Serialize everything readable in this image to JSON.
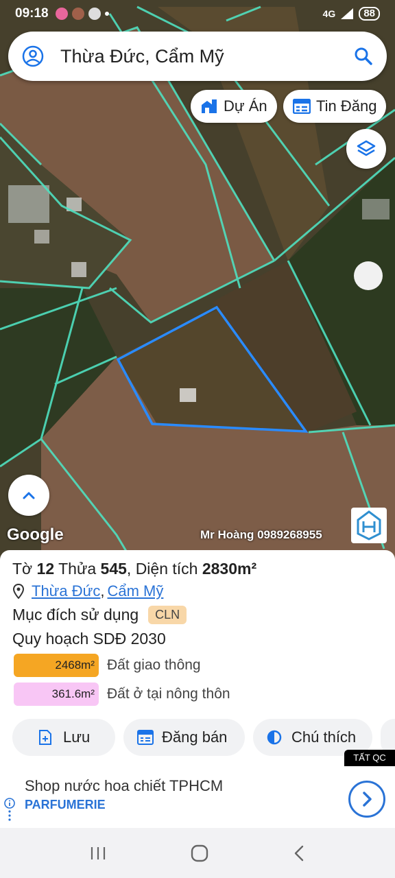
{
  "status_bar": {
    "time": "09:18",
    "network": "4G",
    "battery": "88"
  },
  "search": {
    "query": "Thừa Đức, Cẩm Mỹ"
  },
  "chips": {
    "projects": "Dự Án",
    "listings": "Tin Đăng"
  },
  "map": {
    "attribution": "Google",
    "watermark": "Mr Hoàng 0989268955"
  },
  "parcel": {
    "sheet_label": "Tờ",
    "sheet_no": "12",
    "plot_label": "Thửa",
    "plot_no": "545",
    "area_label": "Diện tích",
    "area_value": "2830m²",
    "commune": "Thừa Đức",
    "district": "Cẩm Mỹ",
    "purpose_label": "Mục đích sử dụng",
    "purpose_code": "CLN",
    "plan_label": "Quy hoạch SDĐ 2030",
    "zones": [
      {
        "area": "2468m²",
        "name": "Đất giao thông",
        "color": "#f5a623"
      },
      {
        "area": "361.6m²",
        "name": "Đất ở tại nông thôn",
        "color": "#f8c6f5"
      }
    ]
  },
  "actions": {
    "save": "Lưu",
    "post": "Đăng bán",
    "legend": "Chú thích"
  },
  "ad": {
    "tag": "TẤT QC",
    "headline": "Shop nước hoa chiết TPHCM",
    "sponsor": "PARFUMERIE"
  }
}
